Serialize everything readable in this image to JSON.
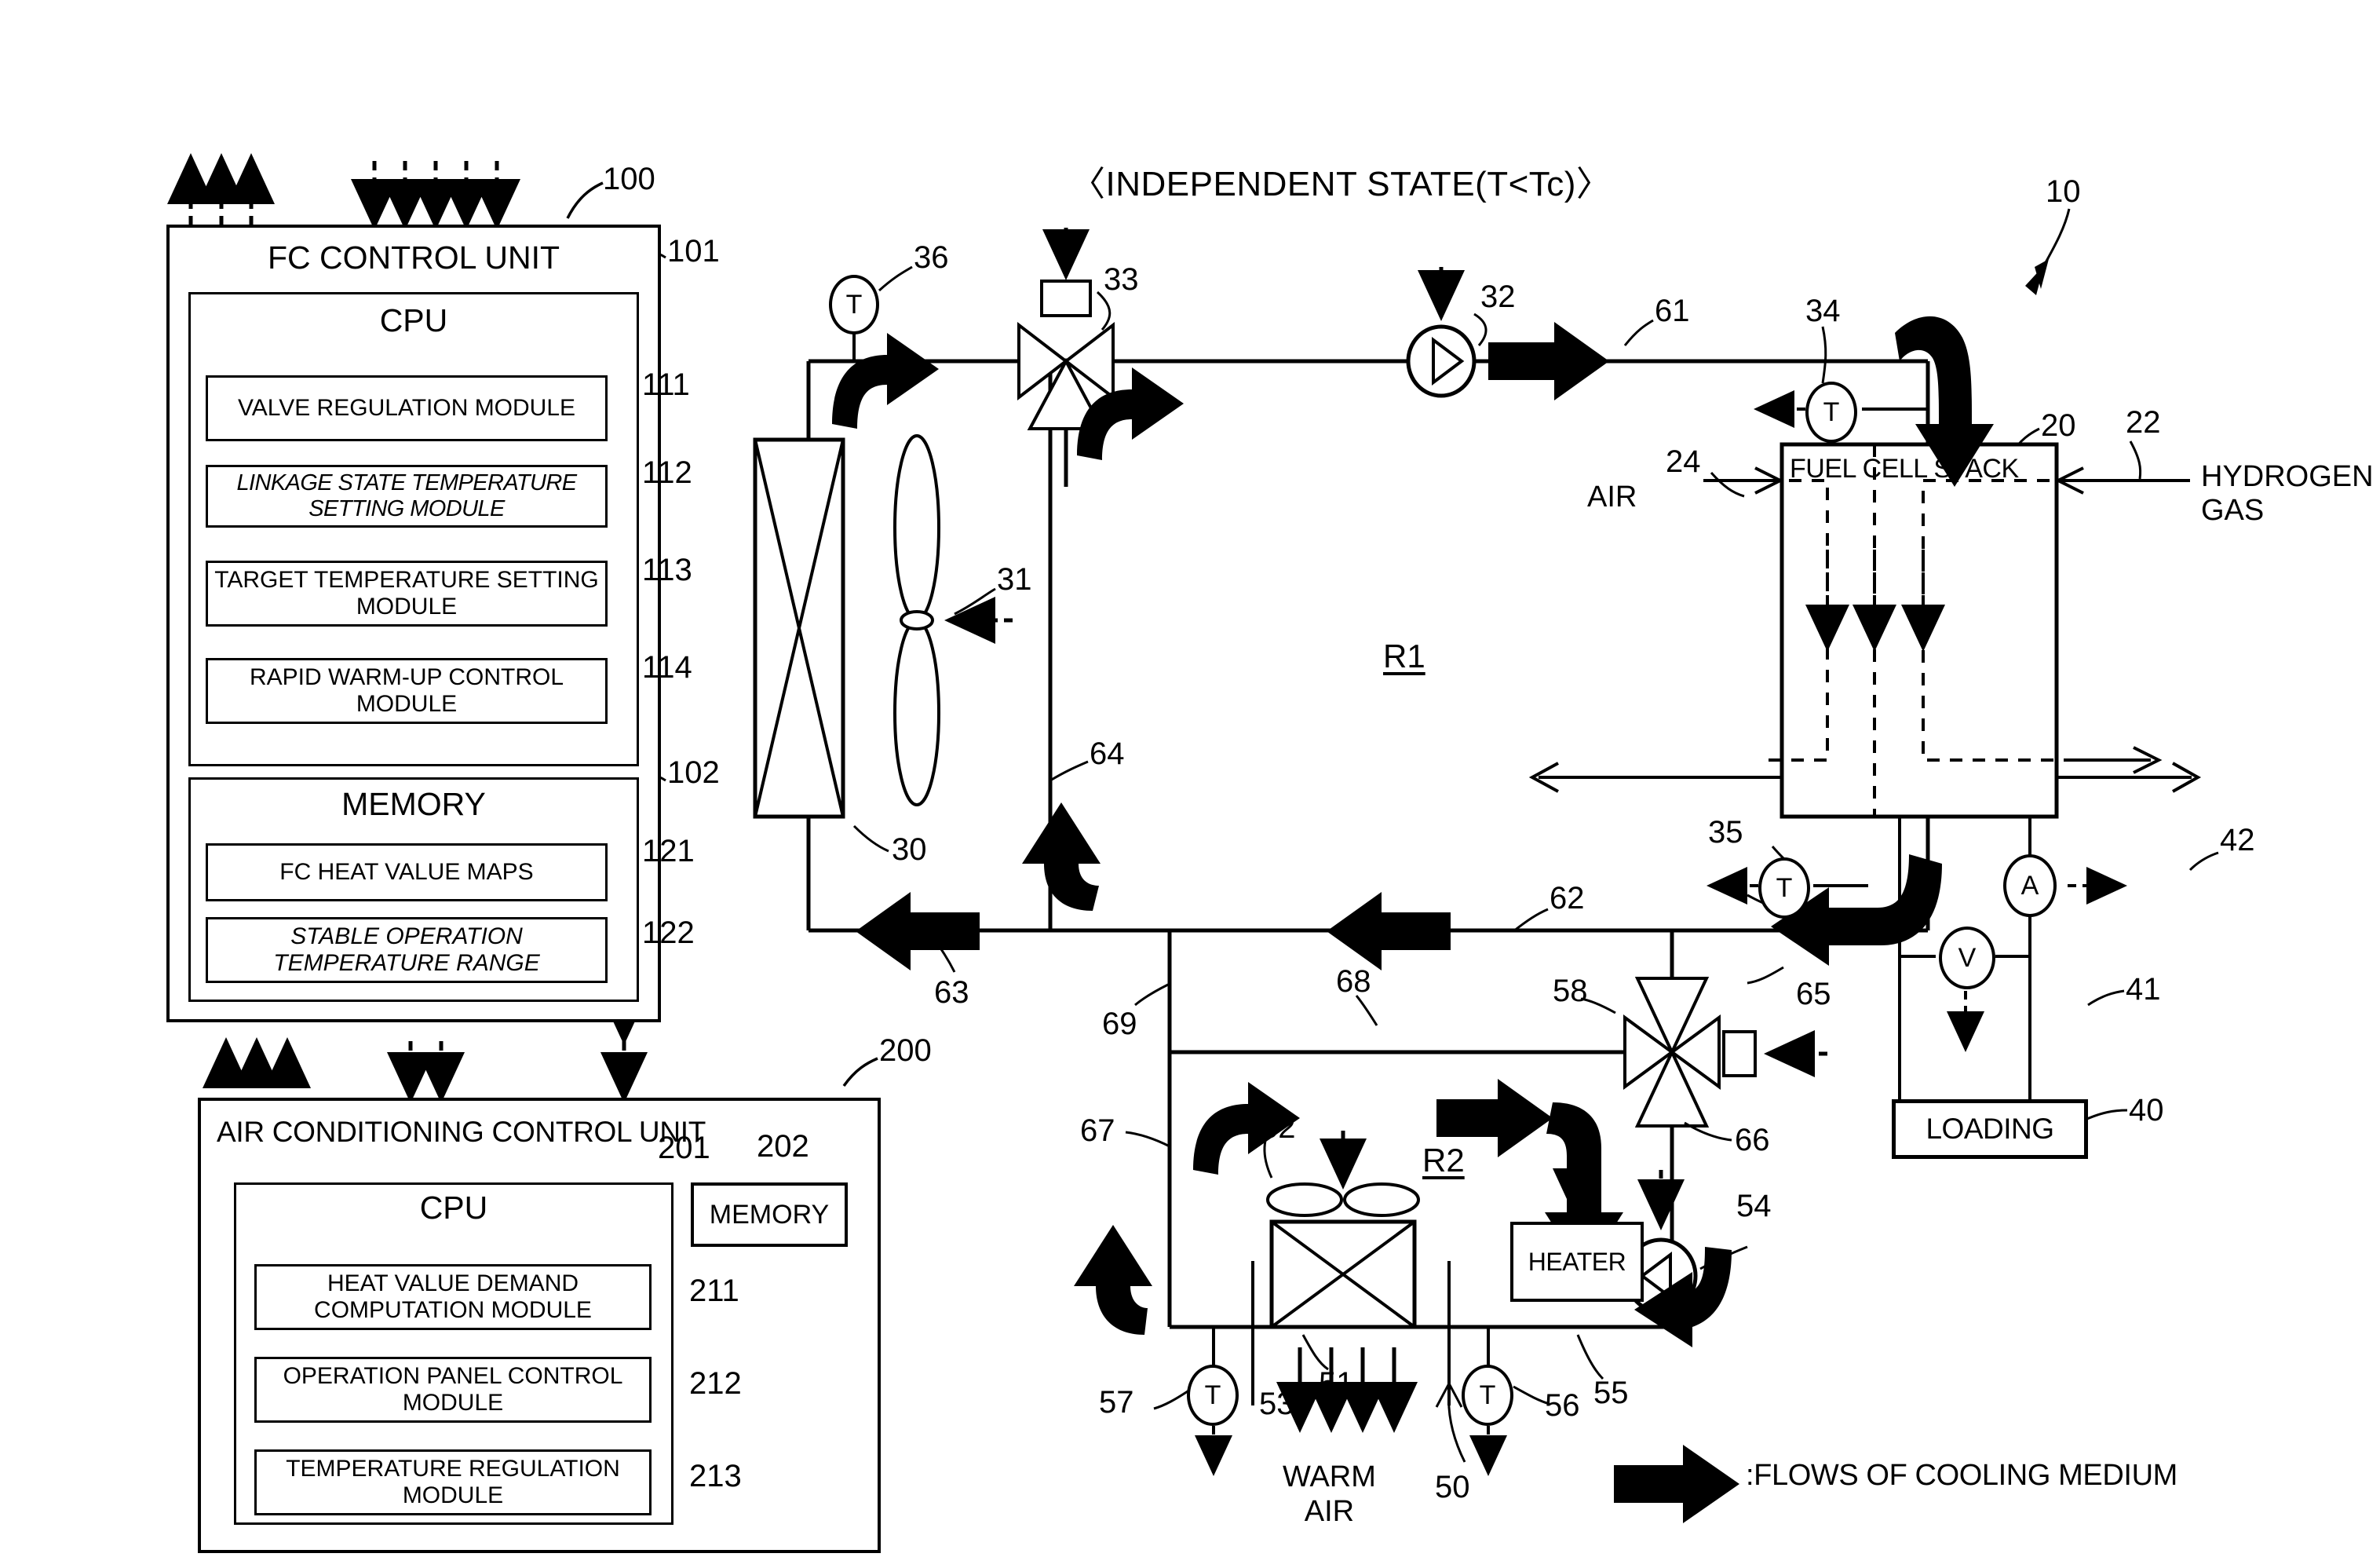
{
  "figure": {
    "title": "〈INDEPENDENT STATE(T<Tc)〉",
    "system_ref": "10"
  },
  "fc_control_unit": {
    "title": "FC CONTROL UNIT",
    "ref": "100",
    "cpu": {
      "title": "CPU",
      "ref": "101",
      "modules": [
        {
          "label": "VALVE REGULATION\nMODULE",
          "ref": "111"
        },
        {
          "label": "LINKAGE STATE TEMPERATURE\nSETTING MODULE",
          "ref": "112"
        },
        {
          "label": "TARGET TEMPERATURE\nSETTING MODULE",
          "ref": "113"
        },
        {
          "label": "RAPID WARM-UP\nCONTROL MODULE",
          "ref": "114"
        }
      ]
    },
    "memory": {
      "title": "MEMORY",
      "ref": "102",
      "items": [
        {
          "label": "FC HEAT VALUE MAPS",
          "ref": "121"
        },
        {
          "label": "STABLE OPERATION\nTEMPERATURE RANGE",
          "ref": "122"
        }
      ]
    }
  },
  "air_conditioning_control_unit": {
    "title": "AIR CONDITIONING CONTROL UNIT",
    "ref": "200",
    "cpu": {
      "title": "CPU",
      "ref": "201"
    },
    "memory": {
      "title": "MEMORY",
      "ref": "202"
    },
    "modules": [
      {
        "label": "HEAT VALUE DEMAND\nCOMPUTATION MODULE",
        "ref": "211"
      },
      {
        "label": "OPERATION PANEL\nCONTROL MODULE",
        "ref": "212"
      },
      {
        "label": "TEMPERATURE\nREGULATION MODULE",
        "ref": "213"
      }
    ]
  },
  "fuel_cell": {
    "stack_label": "FUEL CELL STACK",
    "stack_ref": "20",
    "air_label": "AIR",
    "air_ref": "24",
    "hydrogen_label": "HYDROGEN\nGAS",
    "hydrogen_ref": "22",
    "loading_label": "LOADING",
    "loading_ref": "40",
    "voltmeter_symbol": "V",
    "voltmeter_ref": "41",
    "ammeter_symbol": "A",
    "ammeter_ref": "42"
  },
  "circuit_r1": {
    "label": "R1",
    "radiator_ref": "30",
    "fan_ref": "31",
    "pump_ref": "32",
    "valve_ref": "33",
    "sensor_inlet_ref": "34",
    "sensor_outlet_ref": "35",
    "sensor_radiator_ref": "36",
    "pipes": [
      {
        "ref": "61"
      },
      {
        "ref": "62"
      },
      {
        "ref": "63"
      },
      {
        "ref": "64"
      },
      {
        "ref": "65"
      }
    ]
  },
  "circuit_r2": {
    "label": "R2",
    "heat_exchanger_ref": "51",
    "fan_ref": "52",
    "warm_air_ref": "53",
    "warm_air_label": "WARM\nAIR",
    "pump_ref": "54",
    "heater_label": "HEATER",
    "heater_ref": "55",
    "sensor_out_ref": "56",
    "sensor_in_ref": "57",
    "valve_ref": "58",
    "air_cond_ref": "50",
    "pipes": [
      {
        "ref": "66"
      },
      {
        "ref": "67"
      },
      {
        "ref": "68"
      },
      {
        "ref": "69"
      }
    ]
  },
  "legend": {
    "text": ":FLOWS OF COOLING MEDIUM"
  },
  "sensor_symbol": "T",
  "colors": {
    "line": "#000000",
    "background": "#ffffff"
  }
}
